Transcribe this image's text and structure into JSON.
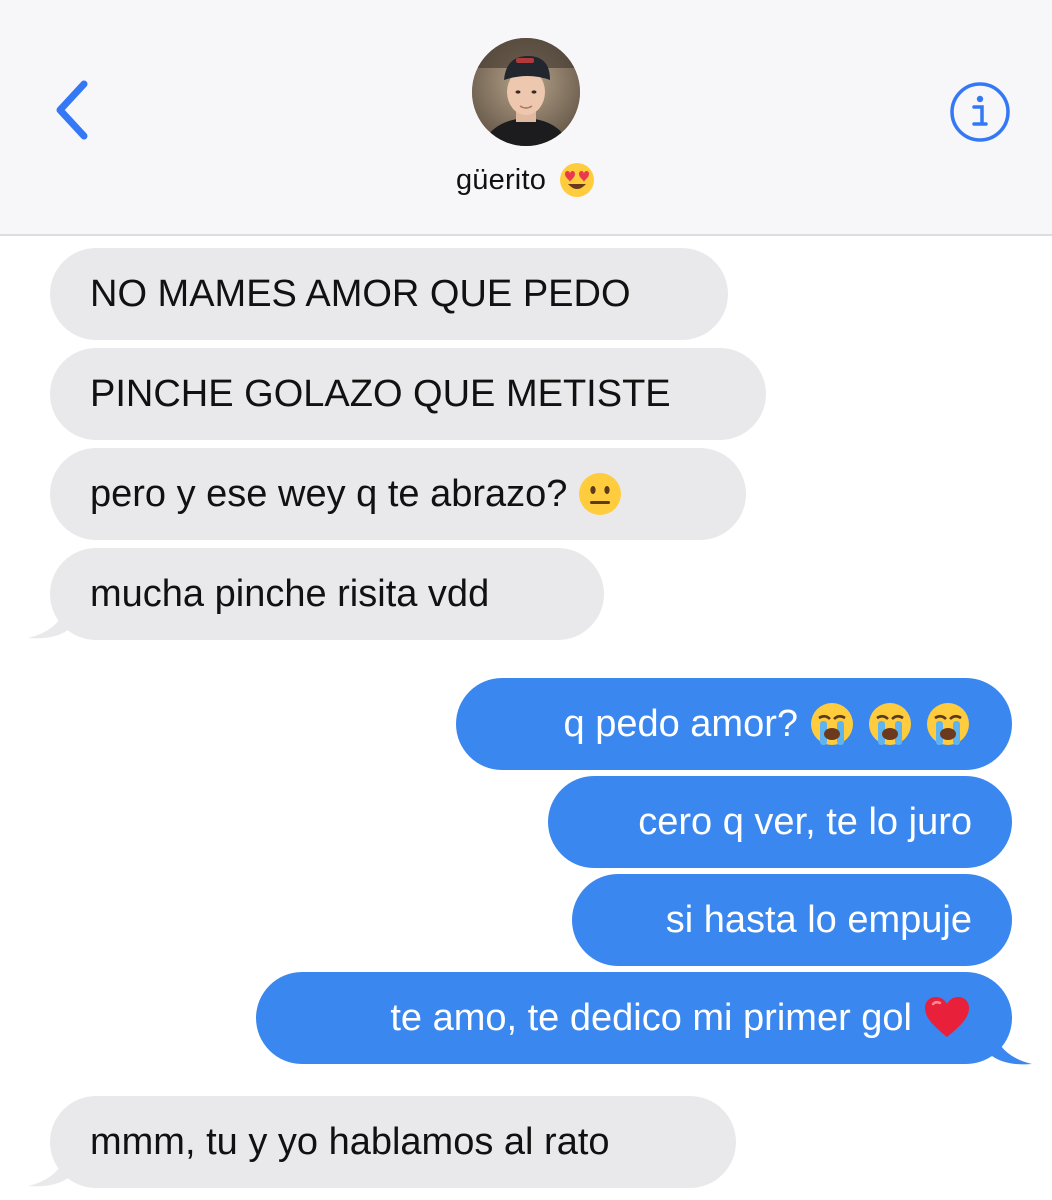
{
  "header": {
    "contact_name": "güerito",
    "name_emoji": "heart-eyes-emoji",
    "back_icon": "chevron-left-icon",
    "info_icon": "info-circle-icon"
  },
  "colors": {
    "incoming_bubble": "#e9e9eb",
    "outgoing_bubble": "#3b87f0",
    "accent": "#3478f6"
  },
  "messages": [
    {
      "direction": "incoming",
      "text": "NO MAMES AMOR QUE PEDO"
    },
    {
      "direction": "incoming",
      "text": "PINCHE GOLAZO QUE METISTE"
    },
    {
      "direction": "incoming",
      "text": "pero y ese wey q te abrazo?",
      "emoji": "neutral-face-emoji"
    },
    {
      "direction": "incoming",
      "text": "mucha pinche risita vdd"
    },
    {
      "direction": "outgoing",
      "text": "q pedo amor?",
      "emoji": "loudly-crying-face-emoji x3"
    },
    {
      "direction": "outgoing",
      "text": "cero q ver, te lo juro"
    },
    {
      "direction": "outgoing",
      "text": "si hasta lo empuje"
    },
    {
      "direction": "outgoing",
      "text": "te amo, te dedico mi primer gol",
      "emoji": "red-heart-emoji"
    },
    {
      "direction": "incoming",
      "text": "mmm, tu y yo hablamos al rato"
    }
  ]
}
